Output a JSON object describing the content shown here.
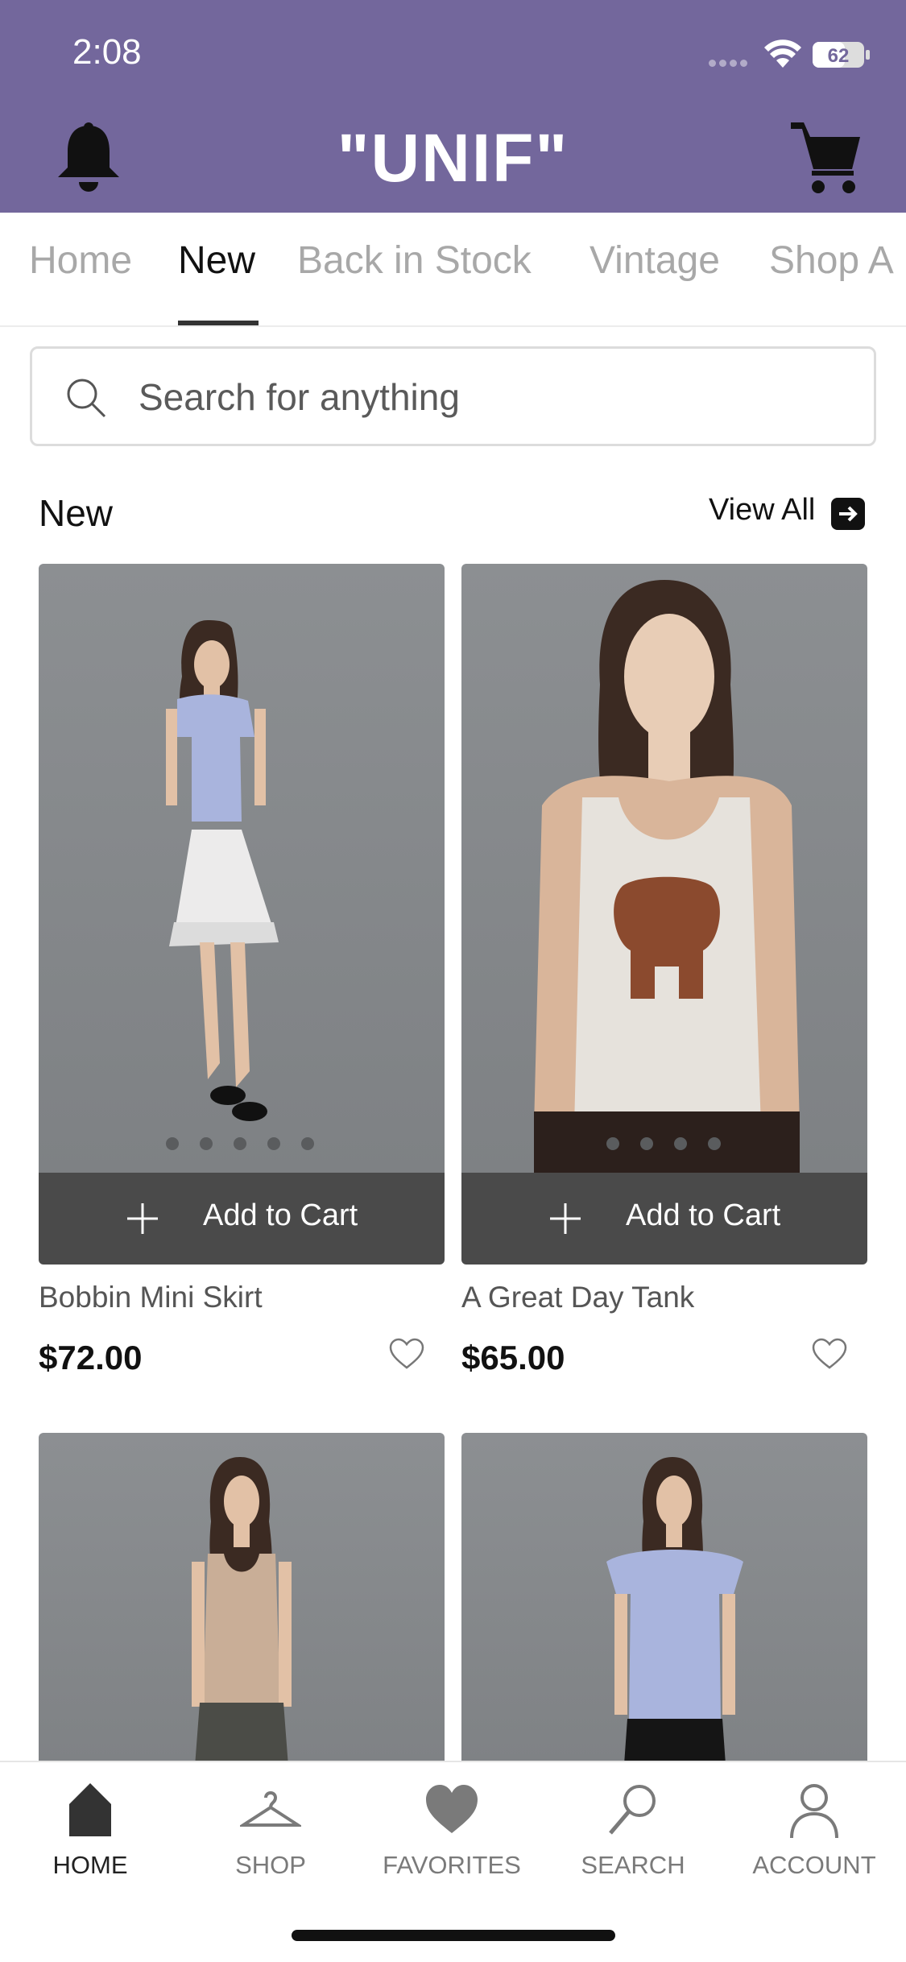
{
  "status_bar": {
    "time": "2:08",
    "battery": "62"
  },
  "header": {
    "logo": "\"UNIF\"",
    "bell_icon": "bell-icon",
    "cart_icon": "cart-icon"
  },
  "tabs": [
    {
      "label": "Home",
      "active": false
    },
    {
      "label": "New",
      "active": true
    },
    {
      "label": "Back in Stock",
      "active": false
    },
    {
      "label": "Vintage",
      "active": false
    },
    {
      "label": "Shop A",
      "active": false
    }
  ],
  "search": {
    "placeholder": "Search for anything"
  },
  "section": {
    "title": "New",
    "view_all": "View All"
  },
  "products": [
    {
      "name": "Bobbin Mini Skirt",
      "price": "$72.00",
      "add_to_cart": "Add to Cart",
      "image_dots": 5
    },
    {
      "name": "A Great Day Tank",
      "price": "$65.00",
      "add_to_cart": "Add to Cart",
      "image_dots": 4
    },
    {
      "name": "",
      "price": "",
      "add_to_cart": "",
      "image_dots": 0
    },
    {
      "name": "",
      "price": "",
      "add_to_cart": "",
      "image_dots": 0
    }
  ],
  "bottom_nav": [
    {
      "label": "HOME",
      "icon": "home-icon",
      "active": true
    },
    {
      "label": "SHOP",
      "icon": "hanger-icon",
      "active": false
    },
    {
      "label": "FAVORITES",
      "icon": "heart-icon",
      "active": false
    },
    {
      "label": "SEARCH",
      "icon": "search-icon",
      "active": false
    },
    {
      "label": "ACCOUNT",
      "icon": "user-icon",
      "active": false
    }
  ],
  "colors": {
    "header_bg": "#73679c",
    "add_to_cart_bg": "#4a4a4a",
    "active_text": "#111111",
    "inactive_text": "#a8a8a8"
  }
}
